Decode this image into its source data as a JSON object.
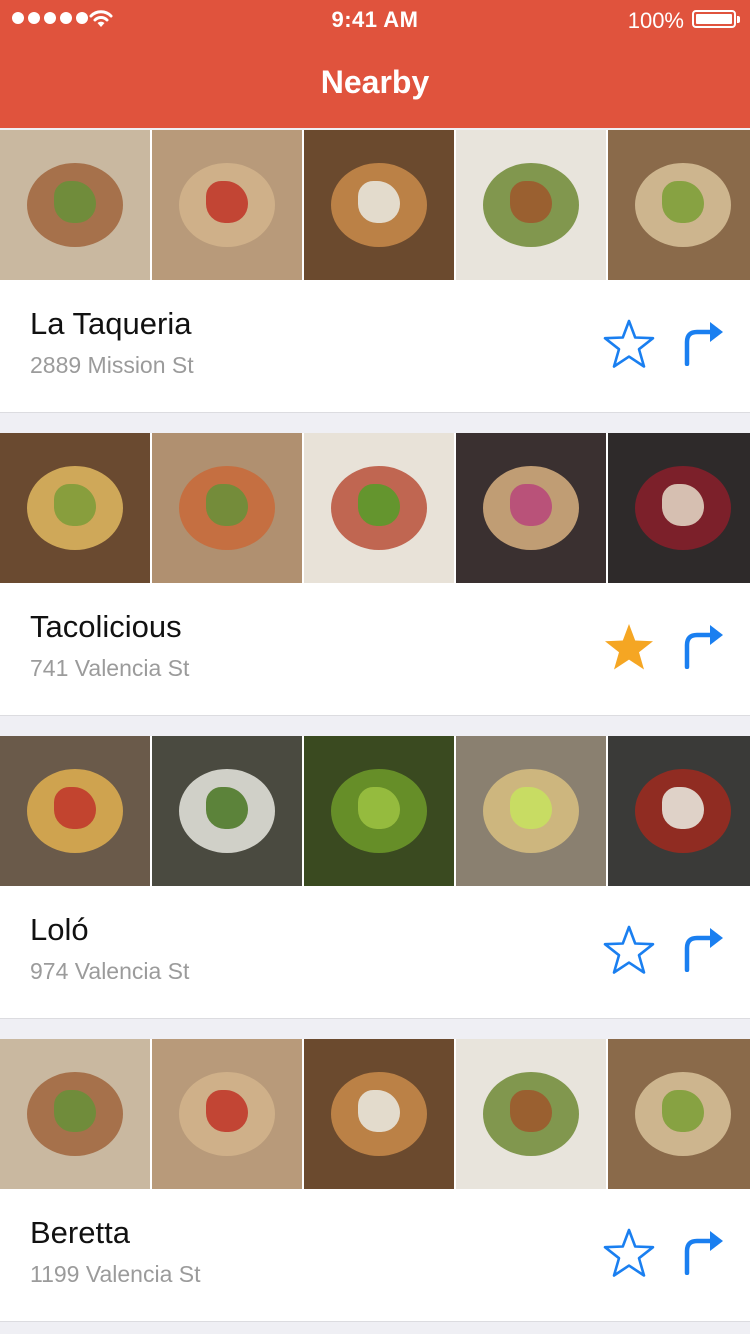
{
  "status_bar": {
    "time": "9:41 AM",
    "battery": "100%",
    "signal_icon": "signal-dots-icon",
    "wifi_icon": "wifi-icon",
    "battery_icon": "battery-icon"
  },
  "nav": {
    "title": "Nearby"
  },
  "colors": {
    "header": "#e0533d",
    "accent_blue": "#1a7ff0",
    "star_filled": "#f5a623",
    "address_gray": "#9b9b9b"
  },
  "restaurants": [
    {
      "name": "La Taqueria",
      "address": "2889 Mission St",
      "favorited": false,
      "photos": [
        {
          "bg": "#c9b8a0",
          "plate": "#a0643c",
          "garnish": "#6a8f3a"
        },
        {
          "bg": "#b89a7a",
          "plate": "#d2b48c",
          "garnish": "#c03a2b"
        },
        {
          "bg": "#6b4a2e",
          "plate": "#c98b4a",
          "garnish": "#e8e4da"
        },
        {
          "bg": "#e8e4dc",
          "plate": "#6f8a35",
          "garnish": "#9c5a2e"
        },
        {
          "bg": "#8a6a4a",
          "plate": "#d8c29a",
          "garnish": "#7fa03a"
        }
      ]
    },
    {
      "name": "Tacolicious",
      "address": "741 Valencia St",
      "favorited": true,
      "photos": [
        {
          "bg": "#6a4a30",
          "plate": "#e0b860",
          "garnish": "#7f9c3a"
        },
        {
          "bg": "#b09070",
          "plate": "#c96a38",
          "garnish": "#6a8f3a"
        },
        {
          "bg": "#e8e2d8",
          "plate": "#b8503a",
          "garnish": "#5a9a2a"
        },
        {
          "bg": "#3a3030",
          "plate": "#d8b080",
          "garnish": "#b84a7a"
        },
        {
          "bg": "#2e2a2a",
          "plate": "#8a1e2a",
          "garnish": "#e0d0c0"
        }
      ]
    },
    {
      "name": "Loló",
      "address": "974 Valencia St",
      "favorited": false,
      "photos": [
        {
          "bg": "#6a5a4a",
          "plate": "#e0b050",
          "garnish": "#c03a2b"
        },
        {
          "bg": "#4a4a40",
          "plate": "#e8e8e0",
          "garnish": "#4f7a2a"
        },
        {
          "bg": "#3a4a20",
          "plate": "#6f9a2a",
          "garnish": "#9ac040"
        },
        {
          "bg": "#8a8070",
          "plate": "#d8c080",
          "garnish": "#c8e060"
        },
        {
          "bg": "#3a3a38",
          "plate": "#a02a1e",
          "garnish": "#e8e4da"
        }
      ]
    },
    {
      "name": "Beretta",
      "address": "1199 Valencia St",
      "favorited": false,
      "photos": [
        {
          "bg": "#c9b8a0",
          "plate": "#a0643c",
          "garnish": "#6a8f3a"
        },
        {
          "bg": "#b89a7a",
          "plate": "#d2b48c",
          "garnish": "#c03a2b"
        },
        {
          "bg": "#6b4a2e",
          "plate": "#c98b4a",
          "garnish": "#e8e4da"
        },
        {
          "bg": "#e8e4dc",
          "plate": "#6f8a35",
          "garnish": "#9c5a2e"
        },
        {
          "bg": "#8a6a4a",
          "plate": "#d8c29a",
          "garnish": "#7fa03a"
        }
      ]
    }
  ]
}
